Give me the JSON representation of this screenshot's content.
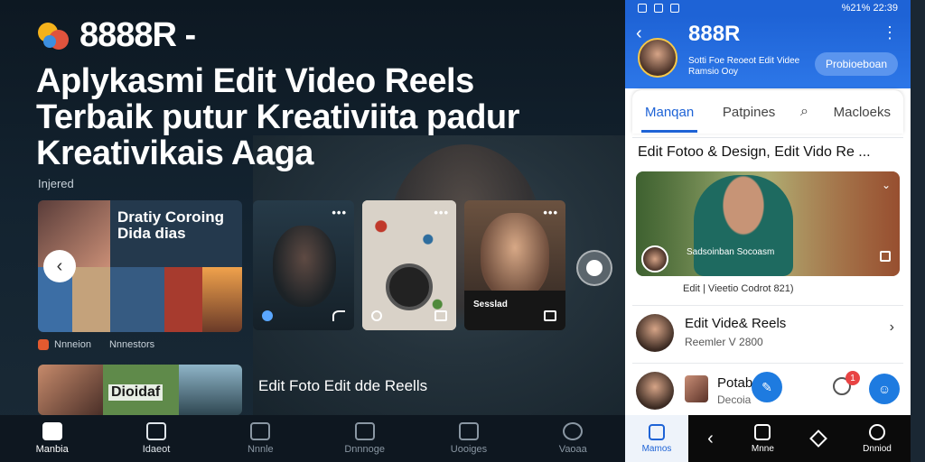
{
  "brand": {
    "title": "8888R -"
  },
  "headline": "Aplykasmi Edit Video Reels Terbaik putur Kreativiita padur Kreativikais Aaga",
  "sublabel": "Injered",
  "cards": {
    "card1_title": "Dratiy Coroing Dida dias",
    "card1_caption": "Nnneion",
    "card1_caption2": "Nnnestors",
    "card2_title": "Dioidaf",
    "card5_text": "Sesslad",
    "more": "•••"
  },
  "overlay_text": "Edit Foto Edit dde Reells",
  "bottom_nav": [
    {
      "label": "Manbia",
      "icon": "home-icon"
    },
    {
      "label": "Idaeot",
      "icon": "video-icon"
    },
    {
      "label": "Nnnle",
      "icon": "edit-icon"
    },
    {
      "label": "Dnnnoge",
      "icon": "upload-icon"
    },
    {
      "label": "Uooiges",
      "icon": "gallery-icon"
    },
    {
      "label": "Vaoaa",
      "icon": "sparkle-icon"
    }
  ],
  "phone": {
    "status_time": "%21% 22:39",
    "title": "888R",
    "subtitle": "Sotti Foe Reoeot Edit Videe Ramsio Ooy",
    "header_button": "Probioeboan",
    "tabs": [
      "Manqan",
      "Patpines",
      "Macloeks"
    ],
    "section_title": "Edit Fotoo & Design, Edit Vido Re ...",
    "featured_name": "Sadsoinban Socoasm",
    "featured_caption": "Edit | Vieetio Codrot 821)",
    "item1_title": "Edit Vide& Reels",
    "item1_sub": "Reemler V 2800",
    "item2_title": "Potab",
    "item2_sub": "Decoia",
    "badge": "1",
    "nav": [
      {
        "label": "Mamos",
        "icon": "home-icon"
      },
      {
        "label": "Mnne",
        "icon": "video-icon"
      },
      {
        "label": "Dnniod",
        "icon": "profile-icon"
      }
    ]
  },
  "colors": {
    "accent": "#1e63d6",
    "background": "#0f1a24",
    "badge": "#e84343"
  }
}
